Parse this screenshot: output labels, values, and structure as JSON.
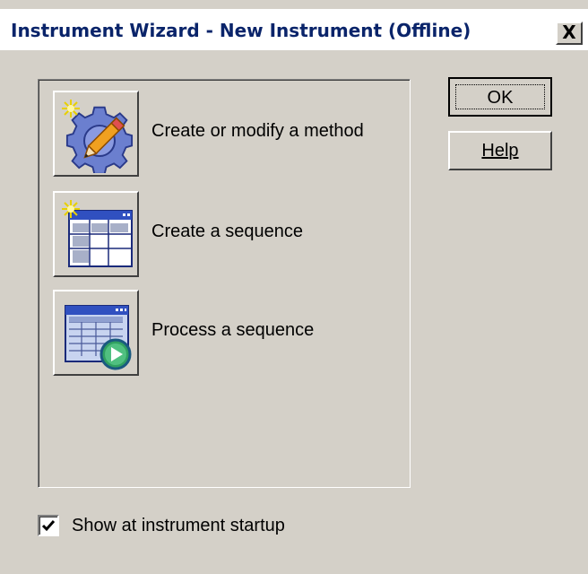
{
  "window": {
    "title": "Instrument Wizard - New Instrument (Offline)",
    "close_label": "X"
  },
  "actions": [
    {
      "label": "Create or modify a method",
      "icon": "method-gear-pencil-icon"
    },
    {
      "label": "Create a sequence",
      "icon": "sequence-table-icon"
    },
    {
      "label": "Process a sequence",
      "icon": "process-sequence-icon"
    }
  ],
  "buttons": {
    "ok_label": "OK",
    "help_label": "Help"
  },
  "startup_option": {
    "label": "Show at instrument startup",
    "checked": true
  },
  "colors": {
    "dialog_face": "#d4d0c8",
    "title_text": "#0a246a"
  }
}
